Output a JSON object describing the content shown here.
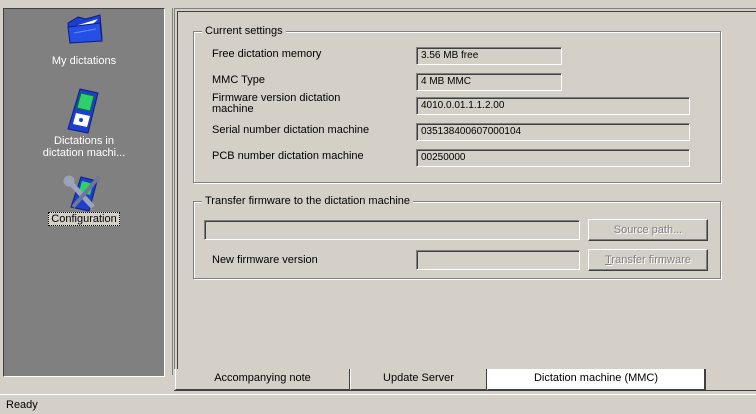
{
  "nav": {
    "items": [
      {
        "label_lines": [
          "My dictations"
        ],
        "icon": "folder-icon"
      },
      {
        "label_lines": [
          "Dictations in",
          "dictation machi..."
        ],
        "icon": "dictation-machine-icon"
      },
      {
        "label_lines": [
          "Configuration"
        ],
        "icon": "configuration-tools-icon",
        "selected": true
      }
    ]
  },
  "current_settings": {
    "title": "Current settings",
    "rows": [
      {
        "label_lines": [
          "Free dictation memory"
        ],
        "value": "3.56 MB free"
      },
      {
        "label_lines": [
          "MMC Type"
        ],
        "value": "4 MB MMC"
      },
      {
        "label_lines": [
          "Firmware version dictation",
          "machine"
        ],
        "value": "4010.0.01.1.1.2.00"
      },
      {
        "label_lines": [
          "Serial number dictation machine"
        ],
        "value": "035138400607000104"
      },
      {
        "label_lines": [
          "PCB number dictation machine"
        ],
        "value": "00250000"
      }
    ]
  },
  "transfer_firmware": {
    "title": "Transfer firmware to the dictation machine",
    "path_value": "",
    "source_path_button": "Source path...",
    "new_version_label": "New firmware version",
    "new_version_value": "",
    "transfer_button_underlined": "T",
    "transfer_button_rest": "ransfer firmware"
  },
  "tabs": [
    {
      "label": "Accompanying note"
    },
    {
      "label": "Update Server"
    },
    {
      "label": "Dictation machine (MMC)",
      "active": true
    }
  ],
  "status": {
    "text": "Ready"
  },
  "colors": {
    "nav_bg": "#808080",
    "window_bg": "#d4d0c8"
  }
}
